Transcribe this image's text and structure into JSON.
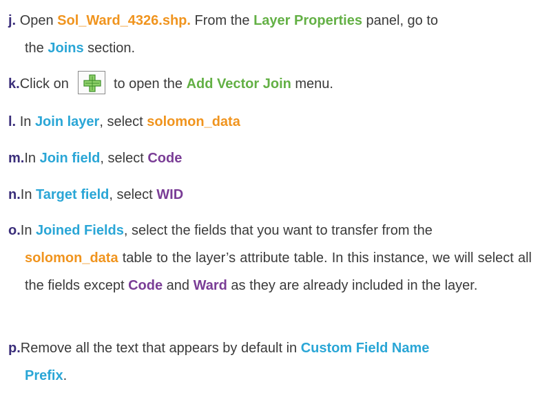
{
  "steps": [
    {
      "marker": "j.",
      "t1": "Open ",
      "file": "Sol_Ward_4326.shp.",
      "t2": " From the ",
      "panel": "Layer Properties",
      "t3": " panel, go to",
      "t4": "the ",
      "section": "Joins",
      "t5": " section."
    },
    {
      "marker": "k.",
      "t1": "Click on ",
      "icon": "add-join-icon",
      "t2": " to open the ",
      "menu": "Add Vector Join",
      "t3": " menu."
    },
    {
      "marker": "l.",
      "t1": "In ",
      "field": "Join layer",
      "t2": ", select ",
      "value": "solomon_data"
    },
    {
      "marker": "m.",
      "t1": "In ",
      "field": "Join field",
      "t2": ", select ",
      "value": "Code"
    },
    {
      "marker": "n.",
      "t1": "In ",
      "field": "Target field",
      "t2": ", select ",
      "value": "WID"
    },
    {
      "marker": "o.",
      "t1": "In ",
      "field": "Joined Fields",
      "t2": ", select the fields that you want to transfer from the",
      "value": "solomon_data",
      "t3": " table to the layer’s attribute table. In this instance, we will select all the fields except ",
      "ex1": "Code",
      "t4": " and ",
      "ex2": "Ward",
      "t5": " as they are already included in the layer."
    },
    {
      "marker": "p.",
      "t1": "Remove all the text that appears by default in ",
      "field1": "Custom Field Name",
      "field2": "Prefix",
      "t2": "."
    }
  ],
  "colors": {
    "orange": "#f0941e",
    "green": "#63b045",
    "blue": "#2aa6d6",
    "purple": "#7a3d96",
    "marker": "#3a2e7a"
  }
}
